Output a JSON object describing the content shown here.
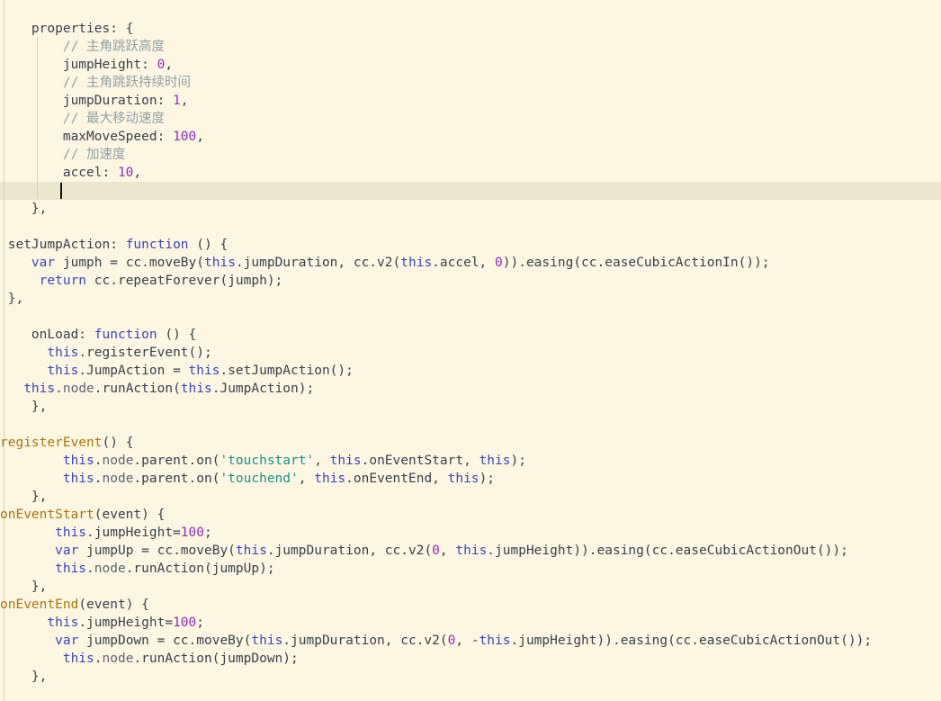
{
  "editor": {
    "theme_colors": {
      "background": "#fdf6e3",
      "current_line": "#ece5cf",
      "keyword": "#3b45b8",
      "function_name": "#a8760e",
      "string": "#1f8f84",
      "number": "#8e2fb7",
      "comment": "#93a1a1"
    },
    "lines": [
      {
        "text": "    properties: {"
      },
      {
        "text": "        // 主角跳跃高度"
      },
      {
        "text": "        jumpHeight: 0,"
      },
      {
        "text": "        // 主角跳跃持续时间"
      },
      {
        "text": "        jumpDuration: 1,"
      },
      {
        "text": "        // 最大移动速度"
      },
      {
        "text": "        maxMoveSpeed: 100,"
      },
      {
        "text": "        // 加速度"
      },
      {
        "text": "        accel: 10,"
      },
      {
        "text": ""
      },
      {
        "text": "    },"
      },
      {
        "text": ""
      },
      {
        "text": " setJumpAction: function () {"
      },
      {
        "text": "    var jumph = cc.moveBy(this.jumpDuration, cc.v2(this.accel, 0)).easing(cc.easeCubicActionIn());"
      },
      {
        "text": "     return cc.repeatForever(jumph);"
      },
      {
        "text": " },"
      },
      {
        "text": ""
      },
      {
        "text": "    onLoad: function () {"
      },
      {
        "text": "      this.registerEvent();"
      },
      {
        "text": "      this.JumpAction = this.setJumpAction();"
      },
      {
        "text": "   this.node.runAction(this.JumpAction);"
      },
      {
        "text": "    },"
      },
      {
        "text": ""
      },
      {
        "text": "registerEvent() {"
      },
      {
        "text": "        this.node.parent.on('touchstart', this.onEventStart, this);"
      },
      {
        "text": "        this.node.parent.on('touchend', this.onEventEnd, this);"
      },
      {
        "text": "    },"
      },
      {
        "text": "onEventStart(event) {"
      },
      {
        "text": "       this.jumpHeight=100;"
      },
      {
        "text": "       var jumpUp = cc.moveBy(this.jumpDuration, cc.v2(0, this.jumpHeight)).easing(cc.easeCubicActionOut());"
      },
      {
        "text": "       this.node.runAction(jumpUp);"
      },
      {
        "text": "    },"
      },
      {
        "text": "onEventEnd(event) {"
      },
      {
        "text": "      this.jumpHeight=100;"
      },
      {
        "text": "       var jumpDown = cc.moveBy(this.jumpDuration, cc.v2(0, -this.jumpHeight)).easing(cc.easeCubicActionOut());"
      },
      {
        "text": "        this.node.runAction(jumpDown);"
      },
      {
        "text": "    },"
      }
    ]
  }
}
